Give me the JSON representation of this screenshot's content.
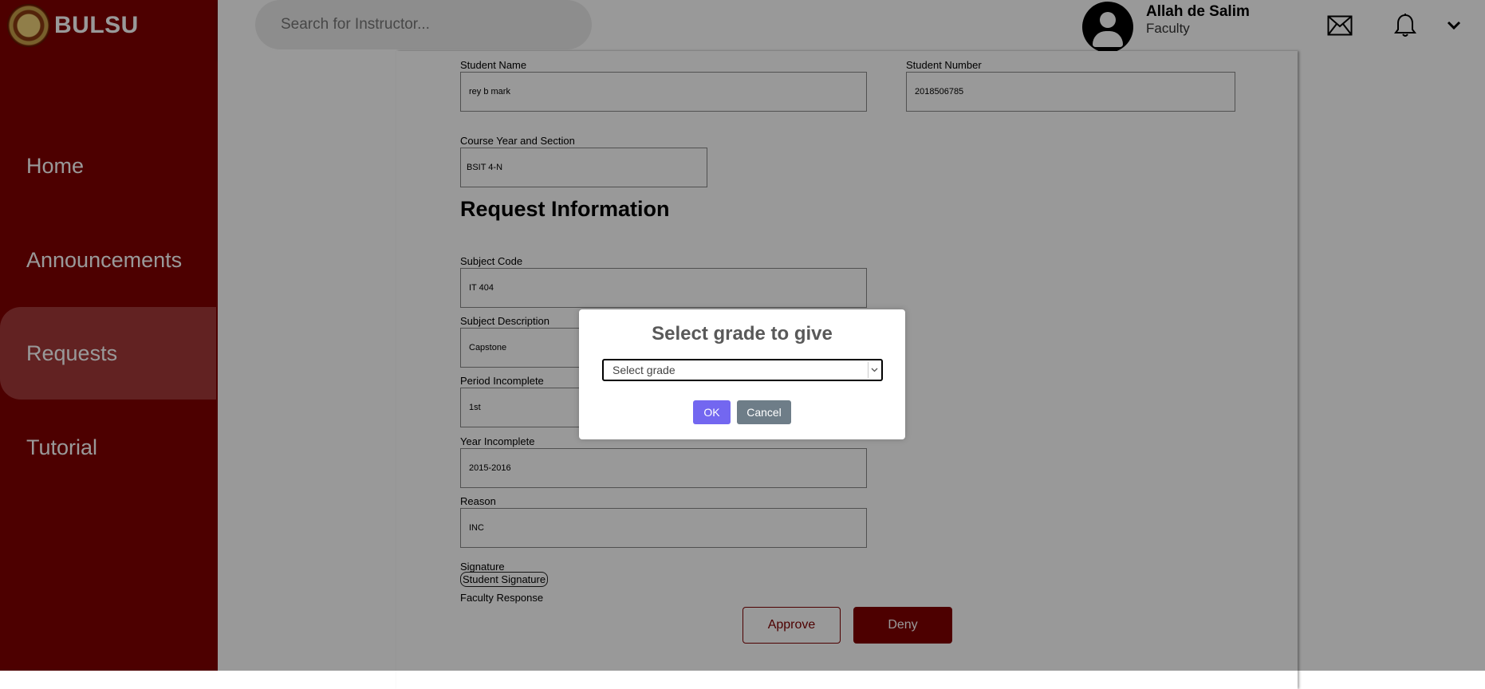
{
  "brand": {
    "name": "BULSU"
  },
  "sidebar": {
    "items": [
      {
        "label": "Home"
      },
      {
        "label": "Announcements"
      },
      {
        "label": "Requests",
        "active": true
      },
      {
        "label": "Tutorial"
      }
    ]
  },
  "header": {
    "search_placeholder": "Search for Instructor...",
    "user_name": "Allah de Salim",
    "user_role": "Faculty"
  },
  "form": {
    "student_name_label": "Student Name",
    "student_name_value": "rey b mark",
    "student_number_label": "Student Number",
    "student_number_value": "2018506785",
    "course_label": "Course Year and Section",
    "course_value": "BSIT 4-N",
    "section_heading": "Request Information",
    "subject_code_label": "Subject Code",
    "subject_code_value": "IT 404",
    "subject_desc_label": "Subject Description",
    "subject_desc_value": "Capstone",
    "period_label": "Period Incomplete",
    "period_value": "1st",
    "year_label": "Year Incomplete",
    "year_value": "2015-2016",
    "reason_label": "Reason",
    "reason_value": "INC",
    "signature_label": "Signature",
    "signature_alt": "Student Signature",
    "faculty_response_label": "Faculty Response",
    "approve_label": "Approve",
    "deny_label": "Deny"
  },
  "modal": {
    "title": "Select grade to give",
    "select_placeholder": "Select grade",
    "ok_label": "OK",
    "cancel_label": "Cancel"
  },
  "colors": {
    "brand": "#800000",
    "ok_button": "#7367f0",
    "cancel_button": "#6e7d88"
  }
}
